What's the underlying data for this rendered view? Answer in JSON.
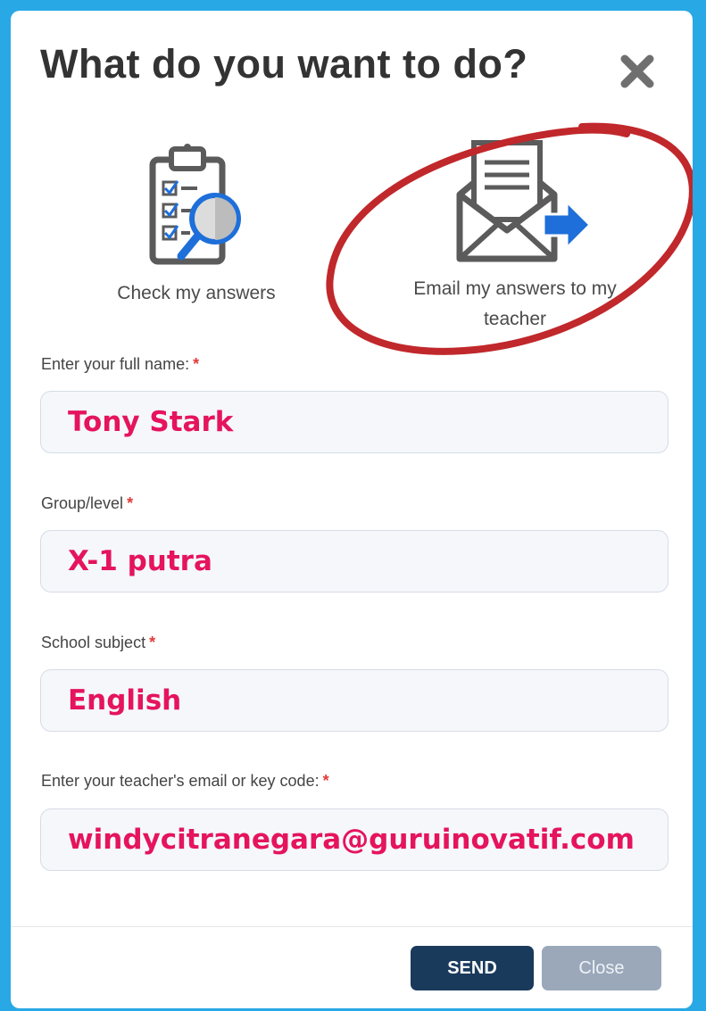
{
  "dialog": {
    "title": "What do you want to do?"
  },
  "options": {
    "check": {
      "label": "Check my answers",
      "icon": "clipboard-checklist-icon"
    },
    "email": {
      "label_line1": "Email my answers to my",
      "label_line2": "teacher",
      "icon": "envelope-send-icon"
    }
  },
  "form": {
    "name": {
      "label": "Enter your full name:",
      "required": "*",
      "value": "Tony Stark"
    },
    "group": {
      "label": "Group/level",
      "required": "*",
      "value": "X-1 putra"
    },
    "subject": {
      "label": "School subject",
      "required": "*",
      "value": "English"
    },
    "email": {
      "label": "Enter your teacher's email or key code:",
      "required": "*",
      "value": "windycitranegara@guruinovatif.com"
    }
  },
  "buttons": {
    "send": "SEND",
    "close": "Close"
  },
  "colors": {
    "background": "#29a8e6",
    "accent_text": "#e5145c",
    "annotation_circle": "#c0282b",
    "send_button": "#1a3a5c",
    "close_button": "#9aa8ba"
  }
}
